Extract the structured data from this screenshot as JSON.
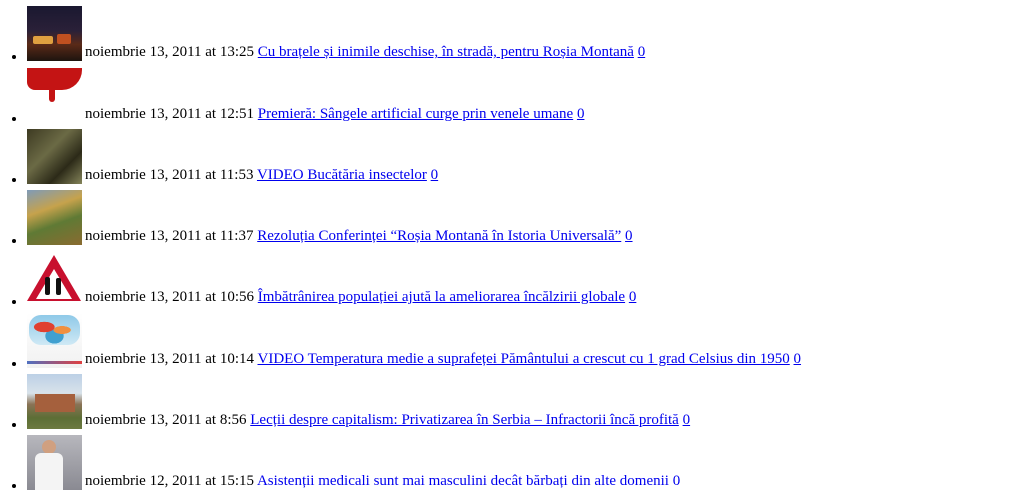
{
  "posts": [
    {
      "date": "noiembrie 13, 2011",
      "at": "at",
      "time": "13:25",
      "title": "Cu brațele și inimile deschise, în stradă, pentru Roșia Montană",
      "comments": "0",
      "thumb_icon": "protest-night-photo"
    },
    {
      "date": "noiembrie 13, 2011",
      "at": "at",
      "time": "12:51",
      "title": "Premieră: Sângele artificial curge prin venele umane",
      "comments": "0",
      "thumb_icon": "blood-drip-photo"
    },
    {
      "date": "noiembrie 13, 2011",
      "at": "at",
      "time": "11:53",
      "title": "VIDEO Bucătăria insectelor",
      "comments": "0",
      "thumb_icon": "insects-food-photo"
    },
    {
      "date": "noiembrie 13, 2011",
      "at": "at",
      "time": "11:37",
      "title": "Rezoluția Conferinței “Roșia Montană în Istoria Universală”",
      "comments": "0",
      "thumb_icon": "autumn-trees-photo"
    },
    {
      "date": "noiembrie 13, 2011",
      "at": "at",
      "time": "10:56",
      "title": "Îmbătrânirea populației ajută la ameliorarea încălzirii globale",
      "comments": "0",
      "thumb_icon": "elderly-sign-photo"
    },
    {
      "date": "noiembrie 13, 2011",
      "at": "at",
      "time": "10:14",
      "title": "VIDEO Temperatura medie a suprafeței Pământului a crescut cu 1 grad Celsius din 1950",
      "comments": "0",
      "thumb_icon": "temperature-map-photo"
    },
    {
      "date": "noiembrie 13, 2011",
      "at": "at",
      "time": "8:56",
      "title": "Lecții despre capitalism: Privatizarea în Serbia – Infractorii încă profită",
      "comments": "0",
      "thumb_icon": "factory-building-photo"
    },
    {
      "date": "noiembrie 12, 2011",
      "at": "at",
      "time": "15:15",
      "title": "Asistenții medicali sunt mai masculini decât bărbați din alte domenii",
      "comments": "0",
      "thumb_icon": "nurse-man-photo"
    }
  ],
  "colors": {
    "link": "#0000ee",
    "text": "#000000",
    "background": "#ffffff"
  }
}
